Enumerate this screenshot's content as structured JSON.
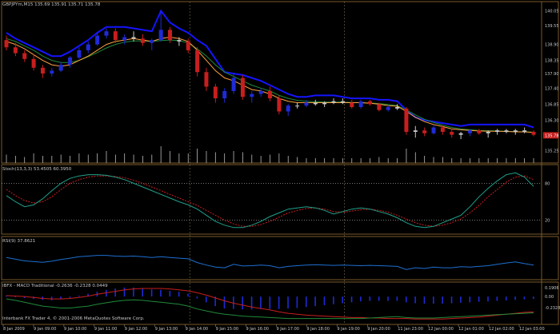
{
  "colors": {
    "background": "#000000",
    "frame": "#7a5a2a",
    "bull_candle": "#1f2bd6",
    "bear_candle": "#c81e1e",
    "doji": "#c8c8c8",
    "envelope": "#1414ff",
    "ma_fast": "#ffa040",
    "ma_slow": "#1f8a3a",
    "stoch_main": "#20a08a",
    "stoch_signal": "#c81e1e",
    "rsi": "#1e6fd0",
    "macd_hist": "#1f2bd6",
    "macd_signal": "#c81e1e",
    "macd_line": "#1f8a3a",
    "price_tag": "#c81e1e"
  },
  "main_pane": {
    "title": "GBPJPYm,M15",
    "ohlc": "135.69 135.91 135.71 135.78",
    "current_price_tag": "135.78"
  },
  "stoch_pane": {
    "title": "Stoch(13,3,3) 53.4505 60.3950"
  },
  "rsi_pane": {
    "title": "RSI(9) 37.8621"
  },
  "macd_pane": {
    "title": "IBFX - MACD Traditional -0.2636 -0.2328 0.0449"
  },
  "footer": {
    "credit": "Interbank FX Trader 4, © 2001-2006 MetaQuotes Software Corp."
  },
  "chart_data": [
    {
      "type": "candlestick",
      "name": "main",
      "y_ticks": [
        "140.05",
        "139.55",
        "138.90",
        "138.35",
        "137.90",
        "137.40",
        "136.85",
        "136.30",
        "135.78",
        "135.25"
      ],
      "x_ticks": [
        "8 Jan 2009",
        "9 Jan 09:00",
        "9 Jan 10:00",
        "9 Jan 11:00",
        "9 Jan 12:00",
        "9 Jan 13:00",
        "9 Jan 14:00",
        "9 Jan 15:00",
        "9 Jan 16:00",
        "9 Jan 17:00",
        "9 Jan 18:00",
        "9 Jan 19:00",
        "9 Jan 20:00",
        "11 Jan 23:00",
        "12 Jan 00:00",
        "12 Jan 01:00",
        "12 Jan 02:00",
        "12 Jan 03:00"
      ],
      "ylim": [
        135.05,
        140.15
      ],
      "grid": false,
      "candles": [
        [
          139.05,
          139.2,
          138.7,
          138.8
        ],
        [
          138.8,
          138.95,
          138.5,
          138.6
        ],
        [
          138.6,
          138.7,
          138.3,
          138.4
        ],
        [
          138.4,
          138.55,
          138.0,
          138.1
        ],
        [
          138.1,
          138.2,
          137.75,
          137.9
        ],
        [
          137.9,
          138.1,
          137.8,
          138.0
        ],
        [
          138.0,
          138.3,
          137.95,
          138.2
        ],
        [
          138.2,
          138.5,
          138.1,
          138.45
        ],
        [
          138.45,
          138.8,
          138.4,
          138.7
        ],
        [
          138.7,
          139.0,
          138.6,
          138.9
        ],
        [
          138.9,
          139.3,
          138.85,
          139.2
        ],
        [
          139.2,
          139.45,
          139.1,
          139.35
        ],
        [
          139.35,
          139.45,
          138.95,
          139.05
        ],
        [
          139.05,
          139.25,
          138.9,
          139.15
        ],
        [
          139.15,
          139.35,
          139.0,
          139.1
        ],
        [
          139.1,
          139.25,
          138.85,
          138.95
        ],
        [
          138.95,
          139.1,
          138.7,
          139.05
        ],
        [
          139.05,
          140.05,
          139.0,
          139.4
        ],
        [
          139.4,
          139.5,
          138.95,
          139.05
        ],
        [
          139.05,
          139.15,
          138.85,
          139.0
        ],
        [
          139.0,
          139.1,
          138.6,
          138.7
        ],
        [
          138.7,
          138.8,
          137.8,
          137.95
        ],
        [
          137.95,
          138.1,
          137.3,
          137.45
        ],
        [
          137.45,
          137.55,
          136.9,
          137.05
        ],
        [
          137.05,
          137.4,
          136.9,
          137.3
        ],
        [
          137.3,
          137.9,
          137.2,
          137.75
        ],
        [
          137.75,
          137.85,
          137.0,
          137.1
        ],
        [
          137.1,
          137.3,
          136.9,
          137.2
        ],
        [
          137.2,
          137.4,
          137.1,
          137.3
        ],
        [
          137.3,
          137.45,
          136.95,
          137.05
        ],
        [
          137.05,
          137.15,
          136.5,
          136.6
        ],
        [
          136.6,
          136.85,
          136.45,
          136.8
        ],
        [
          136.8,
          136.9,
          136.7,
          136.8
        ],
        [
          136.8,
          137.0,
          136.75,
          136.9
        ],
        [
          136.9,
          137.0,
          136.8,
          136.85
        ],
        [
          136.85,
          136.95,
          136.75,
          136.9
        ],
        [
          136.9,
          137.05,
          136.85,
          136.95
        ],
        [
          136.95,
          137.05,
          136.85,
          136.9
        ],
        [
          136.9,
          137.0,
          136.7,
          136.75
        ],
        [
          136.75,
          137.0,
          136.7,
          136.95
        ],
        [
          136.95,
          137.0,
          136.8,
          136.85
        ],
        [
          136.85,
          136.9,
          136.6,
          136.65
        ],
        [
          136.65,
          136.8,
          136.6,
          136.75
        ],
        [
          136.75,
          136.85,
          136.65,
          136.7
        ],
        [
          136.7,
          136.75,
          135.8,
          135.9
        ],
        [
          135.9,
          136.1,
          135.7,
          135.95
        ],
        [
          135.95,
          136.05,
          135.75,
          135.85
        ],
        [
          135.85,
          136.15,
          135.8,
          136.05
        ],
        [
          136.05,
          136.1,
          135.8,
          135.9
        ],
        [
          135.9,
          136.0,
          135.7,
          135.8
        ],
        [
          135.8,
          135.9,
          135.65,
          135.85
        ],
        [
          135.85,
          136.0,
          135.75,
          135.95
        ],
        [
          135.95,
          136.0,
          135.8,
          135.85
        ],
        [
          135.85,
          135.95,
          135.7,
          135.9
        ],
        [
          135.9,
          136.0,
          135.8,
          135.95
        ],
        [
          135.95,
          136.0,
          135.85,
          135.9
        ],
        [
          135.9,
          136.0,
          135.8,
          135.95
        ],
        [
          135.95,
          136.05,
          135.85,
          135.9
        ],
        [
          135.9,
          135.95,
          135.75,
          135.8
        ]
      ],
      "ma_fast": [
        139.0,
        138.9,
        138.75,
        138.55,
        138.35,
        138.2,
        138.15,
        138.2,
        138.35,
        138.5,
        138.7,
        138.9,
        139.0,
        139.05,
        139.1,
        139.05,
        139.0,
        139.1,
        139.15,
        139.1,
        139.0,
        138.7,
        138.35,
        138.0,
        137.75,
        137.65,
        137.5,
        137.35,
        137.3,
        137.2,
        137.05,
        136.95,
        136.9,
        136.9,
        136.9,
        136.9,
        136.9,
        136.9,
        136.9,
        136.9,
        136.88,
        136.85,
        136.8,
        136.78,
        136.6,
        136.4,
        136.25,
        136.15,
        136.08,
        136.0,
        135.97,
        135.95,
        135.93,
        135.92,
        135.92,
        135.91,
        135.9,
        135.9,
        135.88
      ],
      "ma_slow": [
        139.1,
        139.0,
        138.85,
        138.7,
        138.5,
        138.35,
        138.28,
        138.28,
        138.35,
        138.48,
        138.62,
        138.78,
        138.9,
        138.98,
        139.02,
        139.02,
        139.0,
        139.03,
        139.05,
        139.03,
        138.95,
        138.75,
        138.5,
        138.2,
        137.95,
        137.8,
        137.65,
        137.5,
        137.4,
        137.3,
        137.15,
        137.05,
        136.98,
        136.95,
        136.93,
        136.92,
        136.92,
        136.92,
        136.91,
        136.9,
        136.89,
        136.87,
        136.84,
        136.8,
        136.65,
        136.48,
        136.33,
        136.22,
        136.13,
        136.05,
        136.0,
        135.97,
        135.95,
        135.94,
        135.93,
        135.92,
        135.91,
        135.9,
        135.89
      ],
      "envelope_upper": [
        139.3,
        139.1,
        138.95,
        138.8,
        138.65,
        138.5,
        138.5,
        138.65,
        138.85,
        139.05,
        139.3,
        139.5,
        139.5,
        139.5,
        139.45,
        139.4,
        139.35,
        140.05,
        139.65,
        139.45,
        139.3,
        139.05,
        138.85,
        138.4,
        137.95,
        137.9,
        137.85,
        137.75,
        137.65,
        137.5,
        137.35,
        137.2,
        137.1,
        137.1,
        137.15,
        137.15,
        137.15,
        137.1,
        137.05,
        137.05,
        137.05,
        137.0,
        137.0,
        136.95,
        136.65,
        136.4,
        136.3,
        136.25,
        136.2,
        136.15,
        136.1,
        136.15,
        136.15,
        136.15,
        136.15,
        136.15,
        136.15,
        136.15,
        136.05
      ],
      "volume": [
        0.35,
        0.3,
        0.25,
        0.4,
        0.3,
        0.3,
        0.35,
        0.3,
        0.4,
        0.35,
        0.4,
        0.5,
        0.35,
        0.4,
        0.35,
        0.3,
        0.35,
        0.7,
        0.5,
        0.4,
        0.4,
        0.6,
        0.5,
        0.45,
        0.4,
        0.5,
        0.45,
        0.35,
        0.3,
        0.35,
        0.4,
        0.3,
        0.25,
        0.2,
        0.2,
        0.2,
        0.2,
        0.2,
        0.2,
        0.2,
        0.2,
        0.25,
        0.2,
        0.2,
        0.6,
        0.45,
        0.3,
        0.25,
        0.25,
        0.2,
        0.2,
        0.2,
        0.2,
        0.2,
        0.2,
        0.2,
        0.2,
        0.2,
        0.2
      ],
      "legend": "none"
    },
    {
      "type": "line",
      "name": "stochastic",
      "y_ticks": [
        "80",
        "20"
      ],
      "ylim": [
        0,
        100
      ],
      "levels": [
        80,
        20
      ],
      "series": [
        {
          "name": "main",
          "values": [
            60,
            50,
            42,
            45,
            55,
            68,
            80,
            88,
            92,
            94,
            94,
            93,
            90,
            86,
            80,
            74,
            68,
            62,
            56,
            50,
            45,
            38,
            28,
            18,
            12,
            8,
            8,
            12,
            18,
            26,
            32,
            38,
            40,
            42,
            40,
            36,
            30,
            34,
            38,
            40,
            38,
            34,
            30,
            24,
            16,
            10,
            8,
            10,
            16,
            22,
            28,
            42,
            58,
            72,
            84,
            94,
            97,
            90,
            75
          ]
        },
        {
          "name": "signal",
          "values": [
            70,
            60,
            52,
            48,
            50,
            58,
            70,
            80,
            86,
            90,
            92,
            92,
            91,
            89,
            85,
            80,
            74,
            68,
            62,
            56,
            50,
            44,
            36,
            28,
            20,
            14,
            10,
            10,
            13,
            18,
            25,
            32,
            36,
            39,
            40,
            38,
            34,
            33,
            35,
            37,
            38,
            36,
            33,
            28,
            22,
            16,
            12,
            10,
            12,
            16,
            22,
            32,
            44,
            58,
            70,
            82,
            90,
            92,
            86
          ]
        }
      ],
      "legend": "none"
    },
    {
      "type": "line",
      "name": "rsi",
      "ylim": [
        0,
        100
      ],
      "series": [
        {
          "name": "",
          "values": [
            60,
            55,
            50,
            48,
            46,
            49,
            54,
            58,
            62,
            64,
            66,
            66,
            64,
            63,
            64,
            62,
            60,
            62,
            60,
            58,
            56,
            45,
            38,
            32,
            30,
            40,
            35,
            36,
            38,
            36,
            30,
            34,
            36,
            38,
            39,
            38,
            37,
            38,
            37,
            36,
            37,
            36,
            35,
            34,
            25,
            30,
            28,
            32,
            30,
            30,
            33,
            32,
            34,
            36,
            40,
            44,
            47,
            42,
            38
          ]
        }
      ],
      "legend": "none"
    },
    {
      "type": "bar",
      "name": "macd",
      "y_ticks": [
        "0.1906",
        "0.00",
        "-0.2328"
      ],
      "ylim": [
        -0.55,
        0.22
      ],
      "histogram": [
        0.02,
        -0.01,
        -0.03,
        -0.05,
        -0.07,
        -0.08,
        -0.06,
        -0.03,
        0.02,
        0.06,
        0.1,
        0.14,
        0.17,
        0.19,
        0.19,
        0.17,
        0.15,
        0.14,
        0.12,
        0.1,
        0.06,
        -0.04,
        -0.12,
        -0.2,
        -0.25,
        -0.26,
        -0.27,
        -0.27,
        -0.26,
        -0.26,
        -0.26,
        -0.25,
        -0.24,
        -0.22,
        -0.2,
        -0.18,
        -0.16,
        -0.14,
        -0.12,
        -0.1,
        -0.09,
        -0.09,
        -0.09,
        -0.09,
        -0.12,
        -0.14,
        -0.15,
        -0.15,
        -0.15,
        -0.14,
        -0.13,
        -0.12,
        -0.11,
        -0.1,
        -0.09,
        -0.08,
        -0.07,
        -0.06,
        -0.05
      ],
      "series": [
        {
          "name": "signal",
          "values": [
            0.02,
            0.01,
            0.0,
            -0.02,
            -0.04,
            -0.05,
            -0.05,
            -0.04,
            -0.02,
            0.01,
            0.05,
            0.08,
            0.11,
            0.14,
            0.16,
            0.17,
            0.17,
            0.17,
            0.16,
            0.14,
            0.12,
            0.08,
            0.03,
            -0.03,
            -0.09,
            -0.14,
            -0.18,
            -0.22,
            -0.25,
            -0.28,
            -0.32,
            -0.35,
            -0.37,
            -0.39,
            -0.4,
            -0.41,
            -0.42,
            -0.43,
            -0.44,
            -0.44,
            -0.45,
            -0.45,
            -0.46,
            -0.46,
            -0.46,
            -0.47,
            -0.47,
            -0.47,
            -0.47,
            -0.46,
            -0.45,
            -0.44,
            -0.43,
            -0.41,
            -0.39,
            -0.37,
            -0.35,
            -0.33,
            -0.32
          ]
        },
        {
          "name": "macd",
          "values": [
            -0.05,
            -0.08,
            -0.12,
            -0.16,
            -0.2,
            -0.22,
            -0.24,
            -0.24,
            -0.22,
            -0.2,
            -0.16,
            -0.13,
            -0.1,
            -0.08,
            -0.07,
            -0.08,
            -0.1,
            -0.12,
            -0.14,
            -0.16,
            -0.2,
            -0.26,
            -0.3,
            -0.34,
            -0.37,
            -0.39,
            -0.41,
            -0.42,
            -0.43,
            -0.44,
            -0.45,
            -0.46,
            -0.46,
            -0.46,
            -0.46,
            -0.46,
            -0.46,
            -0.46,
            -0.46,
            -0.46,
            -0.45,
            -0.44,
            -0.43,
            -0.42,
            -0.44,
            -0.45,
            -0.45,
            -0.45,
            -0.44,
            -0.43,
            -0.42,
            -0.41,
            -0.4,
            -0.39,
            -0.38,
            -0.37,
            -0.36,
            -0.35,
            -0.34
          ]
        }
      ],
      "legend": "none"
    }
  ]
}
